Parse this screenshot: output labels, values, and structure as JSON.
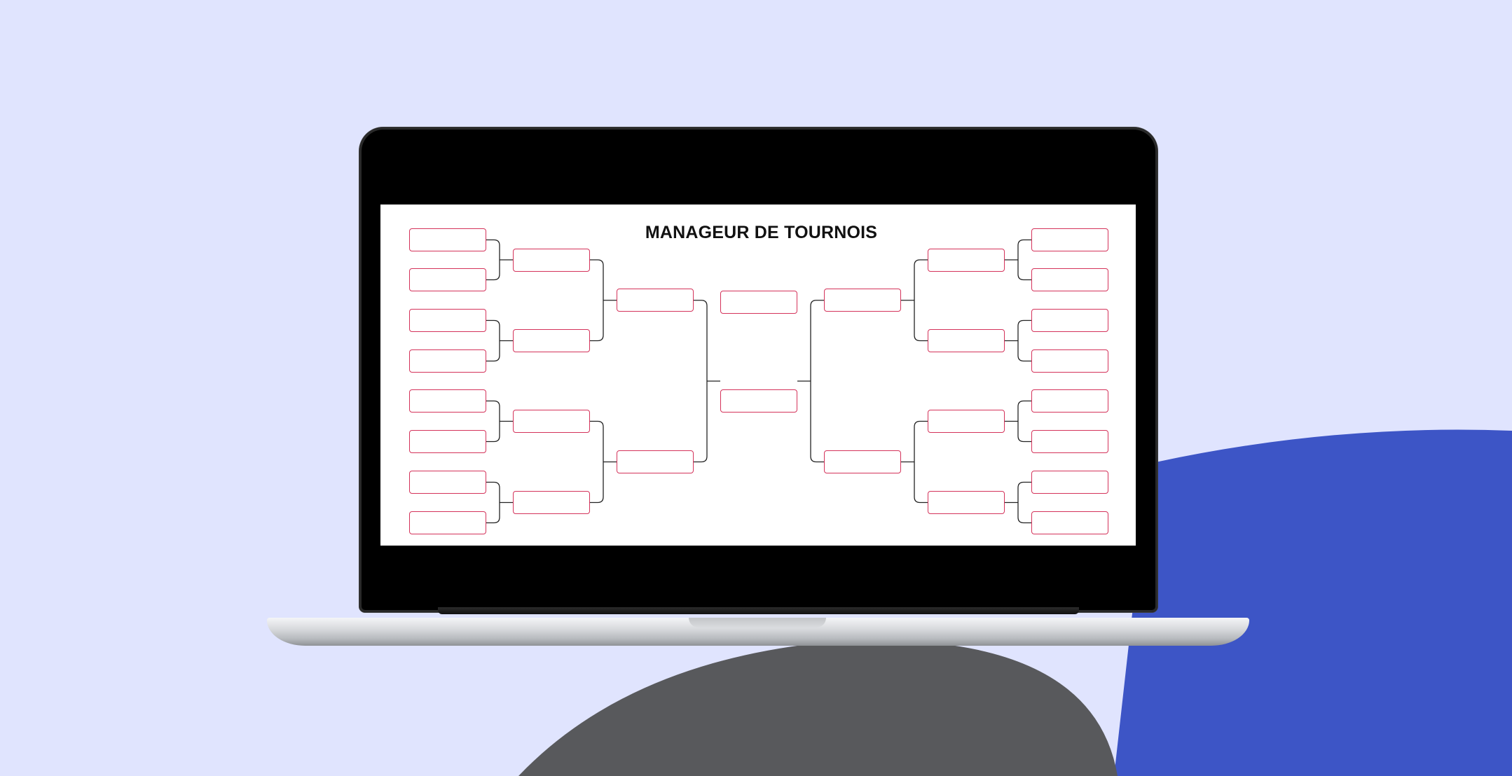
{
  "app": {
    "title": "MANAGEUR DE TOURNOIS"
  },
  "colors": {
    "background": "#e0e4fe",
    "blob_blue": "#3d55c6",
    "blob_gray": "#58595c",
    "slot_border": "#d4325a",
    "connector": "#222222"
  },
  "bracket": {
    "left_round_1": [
      "",
      "",
      "",
      "",
      "",
      "",
      "",
      ""
    ],
    "left_round_2": [
      "",
      "",
      "",
      ""
    ],
    "left_semifinal": [
      "",
      ""
    ],
    "final": [
      "",
      ""
    ],
    "right_semifinal": [
      "",
      ""
    ],
    "right_round_2": [
      "",
      "",
      "",
      ""
    ],
    "right_round_1": [
      "",
      "",
      "",
      "",
      "",
      "",
      "",
      ""
    ]
  }
}
